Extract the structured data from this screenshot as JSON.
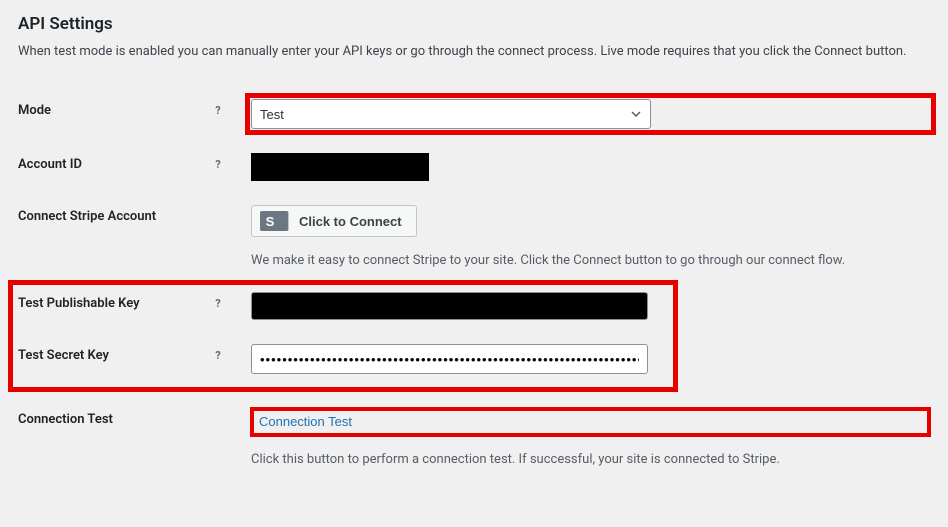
{
  "heading": "API Settings",
  "intro": "When test mode is enabled you can manually enter your API keys or go through the connect process. Live mode requires that you click the Connect button.",
  "mode": {
    "label": "Mode",
    "selected": "Test"
  },
  "accountId": {
    "label": "Account ID"
  },
  "connectStripe": {
    "label": "Connect Stripe Account",
    "buttonLabel": "Click to Connect",
    "stripeS": "S",
    "description": "We make it easy to connect Stripe to your site. Click the Connect button to go through our connect flow."
  },
  "testPubKey": {
    "label": "Test Publishable Key"
  },
  "testSecretKey": {
    "label": "Test Secret Key",
    "value": "••••••••••••••••••••••••••••••••••••••••••••••••••••••••••••••••••••••••••••••••••••••••"
  },
  "connectionTest": {
    "label": "Connection Test",
    "buttonLabel": "Connection Test",
    "description": "Click this button to perform a connection test. If successful, your site is connected to Stripe."
  }
}
